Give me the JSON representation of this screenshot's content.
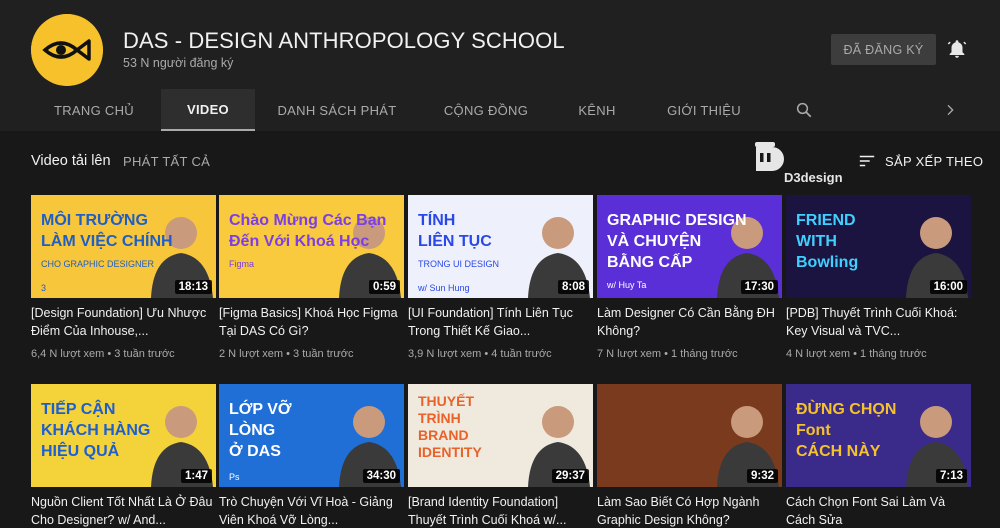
{
  "channel": {
    "name": "DAS - DESIGN ANTHROPOLOGY SCHOOL",
    "subscribers": "53 N người đăng ký",
    "subscribe_label": "ĐÃ ĐĂNG KÝ",
    "avatar_color": "#f6c12b"
  },
  "tabs": [
    {
      "label": "TRANG CHỦ"
    },
    {
      "label": "VIDEO",
      "active": true
    },
    {
      "label": "DANH SÁCH PHÁT"
    },
    {
      "label": "CỘNG ĐỒNG"
    },
    {
      "label": "KÊNH"
    },
    {
      "label": "GIỚI THIỆU"
    }
  ],
  "tab_icons": [
    "search-icon",
    "chevron-right-icon"
  ],
  "section": {
    "title": "Video tải lên",
    "play_all": "PHÁT TẤT CẢ",
    "sort_label": "SẮP XẾP THEO",
    "watermark_text": "D3design"
  },
  "videos": [
    {
      "title": "[Design Foundation] Ưu Nhược Điểm Của Inhouse,...",
      "meta": "6,4 N lượt xem • 3 tuần trước",
      "duration": "18:13",
      "thumb": {
        "bg": "#f7c63a",
        "accent": "#1f5fc4",
        "lines": [
          "MÔI TRƯỜNG",
          "LÀM VIỆC CHÍNH"
        ],
        "small": "CHO GRAPHIC DESIGNER",
        "badge": "3"
      }
    },
    {
      "title": "[Figma Basics] Khoá Học Figma Tại DAS Có Gì?",
      "meta": "2 N lượt xem • 3 tuần trước",
      "duration": "0:59",
      "thumb": {
        "bg": "#f9c93e",
        "accent": "#7b3fe4",
        "lines": [
          "Chào Mừng Các Bạn",
          "Đến Với Khoá Học"
        ],
        "small": "Figma",
        "badge": ""
      }
    },
    {
      "title": "[UI Foundation] Tính Liên Tục Trong Thiết Kế Giao...",
      "meta": "3,9 N lượt xem • 4 tuần trước",
      "duration": "8:08",
      "thumb": {
        "bg": "#eef0fb",
        "accent": "#2a48e8",
        "lines": [
          "TÍNH",
          "LIÊN TỤC"
        ],
        "small": "TRONG UI DESIGN",
        "badge": "w/ Sun Hung"
      }
    },
    {
      "title": "Làm Designer Có Cần Bằng ĐH Không?",
      "meta": "7 N lượt xem • 1 tháng trước",
      "duration": "17:30",
      "thumb": {
        "bg": "#5a2fd8",
        "accent": "#ffffff",
        "lines": [
          "GRAPHIC DESIGN",
          "VÀ CHUYỆN",
          "BẰNG CẤP"
        ],
        "small": "w/ Huy Ta",
        "badge": ""
      }
    },
    {
      "title": "[PDB] Thuyết Trình Cuối Khoá: Key Visual và TVC...",
      "meta": "4 N lượt xem • 1 tháng trước",
      "duration": "16:00",
      "thumb": {
        "bg": "#1b1440",
        "accent": "#3fd0ff",
        "lines": [
          "FRIEND",
          "WITH",
          "Bowling"
        ],
        "small": "",
        "badge": ""
      }
    },
    {
      "title": "Nguồn Client Tốt Nhất Là Ở Đâu Cho Designer? w/ And...",
      "meta": "",
      "duration": "1:47",
      "thumb": {
        "bg": "#f3d23a",
        "accent": "#1e5fd0",
        "lines": [
          "TIẾP CẬN",
          "KHÁCH HÀNG",
          "HIỆU QUẢ"
        ],
        "small": "",
        "badge": ""
      }
    },
    {
      "title": "Trò Chuyện Với Vĩ Hoà - Giảng Viên Khoá Vỡ Lòng...",
      "meta": "",
      "duration": "34:30",
      "thumb": {
        "bg": "#1f6fd6",
        "accent": "#ffffff",
        "lines": [
          "LỚP VỠ",
          "LÒNG",
          "Ở DAS"
        ],
        "small": "",
        "badge": "Ps"
      }
    },
    {
      "title": "[Brand Identity Foundation] Thuyết Trình Cuối Khoá w/...",
      "meta": "",
      "duration": "29:37",
      "thumb": {
        "bg": "#efe9de",
        "accent": "#e8622a",
        "lines": [
          "THUYẾT",
          "TRÌNH",
          "BRAND",
          "IDENTITY"
        ],
        "small": "",
        "badge": ""
      }
    },
    {
      "title": "Làm Sao Biết Có Hợp Ngành Graphic Design Không?",
      "meta": "",
      "duration": "9:32",
      "thumb": {
        "bg": "#7a3a1e",
        "accent": "#f0c9a0",
        "lines": [],
        "small": "",
        "badge": ""
      }
    },
    {
      "title": "Cách Chọn Font Sai Làm Và Cách Sửa",
      "meta": "",
      "duration": "7:13",
      "thumb": {
        "bg": "#3a2a8a",
        "accent": "#f6c22b",
        "lines": [
          "ĐỪNG CHỌN",
          "Font",
          "CÁCH NÀY"
        ],
        "small": "",
        "badge": ""
      }
    }
  ]
}
